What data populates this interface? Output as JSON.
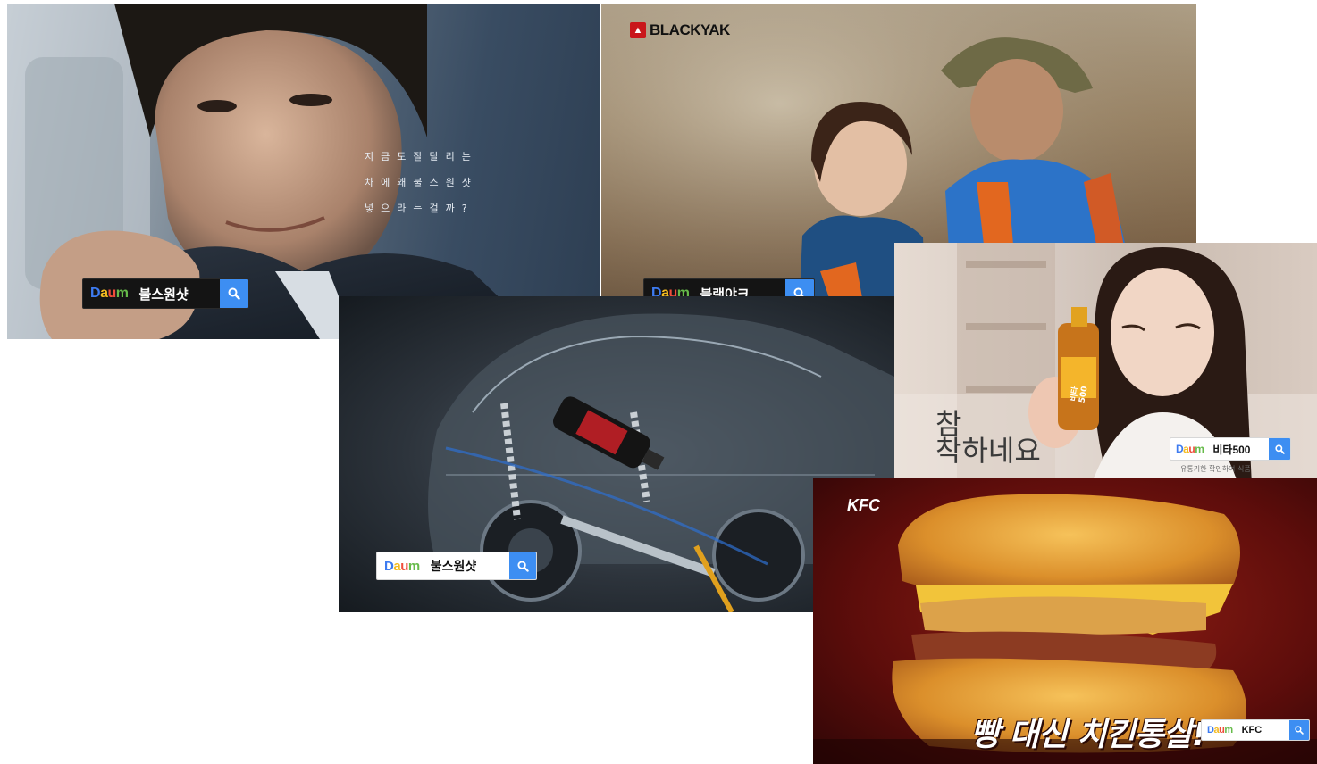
{
  "colors": {
    "daum_blue": "#3d7bf0",
    "daum_yellow": "#f3bb20",
    "daum_red": "#ef4d3b",
    "daum_green": "#66bb4a",
    "search_button": "#3d8ef2",
    "kfc_background": "#6b0f0c"
  },
  "panels": {
    "car_ad_1": {
      "lines": [
        "지금도잘달리는",
        "차에왜불스원샷",
        "넣으라는걸까?"
      ],
      "search": {
        "logo": "Daum",
        "query": "불스원샷",
        "icon": "search-icon"
      }
    },
    "blackyak_ad": {
      "brand": "BLACKYAK",
      "search": {
        "logo": "Daum",
        "query": "블랙야크",
        "icon": "search-icon"
      }
    },
    "car_ad_2": {
      "search": {
        "logo": "Daum",
        "query": "불스원샷",
        "icon": "search-icon"
      }
    },
    "vita_ad": {
      "headline_1": "참",
      "headline_2": "착하네요",
      "bottle_label": "비타500",
      "disclaimer": "유통기한 확인하여 식품",
      "search": {
        "logo": "Daum",
        "query": "비타500",
        "icon": "search-icon"
      }
    },
    "kfc_ad": {
      "brand": "KFC",
      "headline": "빵 대신 치킨통살!",
      "search": {
        "logo": "Daum",
        "query": "KFC",
        "icon": "search-icon"
      }
    }
  }
}
